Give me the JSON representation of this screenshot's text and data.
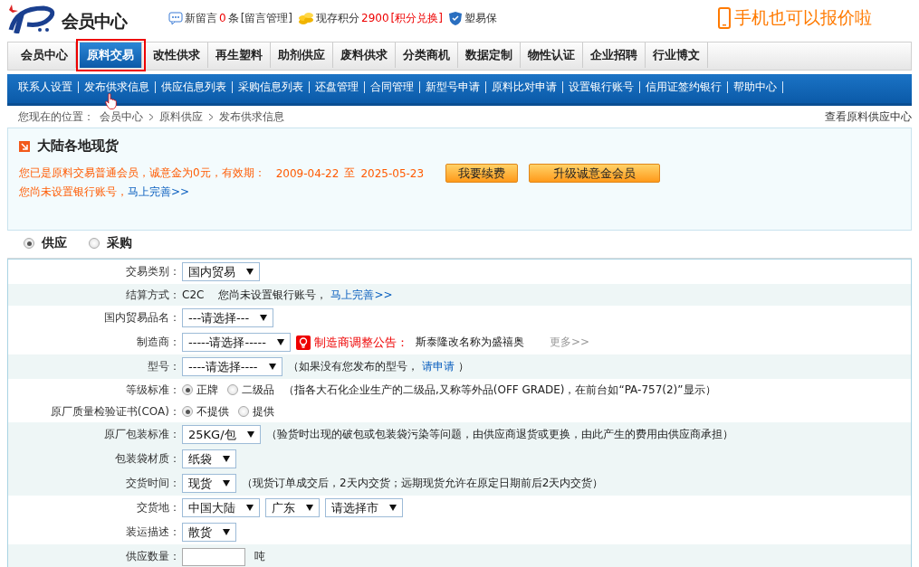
{
  "header": {
    "logo_text": "会员中心",
    "messages": {
      "label": "新留言",
      "count": "0",
      "unit": "条",
      "link": "[留言管理]"
    },
    "points": {
      "label": "现存积分",
      "value": "2900",
      "link": "[积分兑换]"
    },
    "guarantee": "塑易保",
    "promo": "手机也可以报价啦"
  },
  "main_nav": [
    {
      "label": "会员中心",
      "selected": false
    },
    {
      "label": "原料交易",
      "selected": true
    },
    {
      "label": "改性供求",
      "selected": false
    },
    {
      "label": "再生塑料",
      "selected": false
    },
    {
      "label": "助剂供应",
      "selected": false
    },
    {
      "label": "废料供求",
      "selected": false
    },
    {
      "label": "分类商机",
      "selected": false
    },
    {
      "label": "数据定制",
      "selected": false
    },
    {
      "label": "物性认证",
      "selected": false
    },
    {
      "label": "企业招聘",
      "selected": false
    },
    {
      "label": "行业博文",
      "selected": false
    }
  ],
  "sub_nav": [
    "联系人设置",
    "发布供求信息",
    "供应信息列表",
    "采购信息列表",
    "还盘管理",
    "合同管理",
    "新型号申请",
    "原料比对申请",
    "设置银行账号",
    "信用证签约银行",
    "帮助中心"
  ],
  "breadcrumb": {
    "prefix": "您现在的位置：",
    "items": [
      "会员中心",
      "原料供应",
      "发布供求信息"
    ],
    "right_link": "查看原料供应中心"
  },
  "notice": {
    "title": "大陆各地现货",
    "status": "您已是原料交易普通会员，诚意金为0元，有效期：",
    "date_from": "2009-04-22",
    "to": "至",
    "date_to": "2025-05-23",
    "buttons": [
      "我要续费",
      "升级诚意金会员"
    ],
    "bank_text": "您尚未设置银行账号，",
    "bank_link": "马上完善>>"
  },
  "type_switch": [
    {
      "label": "供应",
      "selected": true
    },
    {
      "label": "采购",
      "selected": false
    }
  ],
  "form": [
    {
      "label": "交易类别：",
      "shaded": false,
      "items": [
        {
          "kind": "select",
          "value": "国内贸易"
        }
      ]
    },
    {
      "label": "结算方式：",
      "shaded": true,
      "items": [
        {
          "kind": "text",
          "text": "C2C"
        },
        {
          "kind": "text",
          "text": "您尚未设置银行账号，"
        },
        {
          "kind": "link",
          "text": "马上完善>>"
        }
      ]
    },
    {
      "label": "国内贸易品名：",
      "shaded": false,
      "items": [
        {
          "kind": "select",
          "value": "---请选择---"
        }
      ]
    },
    {
      "label": "制造商：",
      "shaded": false,
      "items": [
        {
          "kind": "select",
          "value": "-----请选择-----"
        },
        {
          "kind": "notice",
          "text": "制造商调整公告："
        },
        {
          "kind": "text",
          "text": "斯泰隆改名称为盛禧奥"
        },
        {
          "kind": "more",
          "text": "更多>>"
        }
      ]
    },
    {
      "label": "型号：",
      "shaded": true,
      "items": [
        {
          "kind": "select",
          "value": "----请选择----"
        },
        {
          "kind": "text",
          "text": "（如果没有您发布的型号，"
        },
        {
          "kind": "link",
          "text": "请申请"
        },
        {
          "kind": "text",
          "text": "）"
        }
      ]
    },
    {
      "label": "等级标准：",
      "shaded": false,
      "items": [
        {
          "kind": "radio",
          "text": "正牌",
          "selected": true
        },
        {
          "kind": "radio",
          "text": "二级品",
          "selected": false
        },
        {
          "kind": "text",
          "text": "（指各大石化企业生产的二级品,又称等外品(OFF GRADE)，在前台如“PA-757(2)”显示）"
        }
      ]
    },
    {
      "label": "原厂质量检验证书(COA)：",
      "shaded": false,
      "items": [
        {
          "kind": "radio",
          "text": "不提供",
          "selected": true
        },
        {
          "kind": "radio",
          "text": "提供",
          "selected": false
        }
      ]
    },
    {
      "label": "原厂包装标准：",
      "shaded": true,
      "items": [
        {
          "kind": "select",
          "value": "25KG/包"
        },
        {
          "kind": "text",
          "text": "（验货时出现的破包或包装袋污染等问题，由供应商退货或更换，由此产生的费用由供应商承担）"
        }
      ]
    },
    {
      "label": "包装袋材质：",
      "shaded": true,
      "items": [
        {
          "kind": "select",
          "value": "纸袋"
        }
      ]
    },
    {
      "label": "交货时间：",
      "shaded": true,
      "items": [
        {
          "kind": "select",
          "value": "现货"
        },
        {
          "kind": "text",
          "text": "（现货订单成交后，2天内交货；远期现货允许在原定日期前后2天内交货）"
        }
      ]
    },
    {
      "label": "交货地：",
      "shaded": false,
      "items": [
        {
          "kind": "select",
          "value": "中国大陆"
        },
        {
          "kind": "select",
          "value": "广东"
        },
        {
          "kind": "select",
          "value": "请选择市"
        }
      ]
    },
    {
      "label": "装运描述：",
      "shaded": false,
      "items": [
        {
          "kind": "select",
          "value": "散货"
        }
      ]
    },
    {
      "label": "供应数量：",
      "shaded": true,
      "items": [
        {
          "kind": "input"
        },
        {
          "kind": "text",
          "text": "吨"
        }
      ]
    }
  ]
}
